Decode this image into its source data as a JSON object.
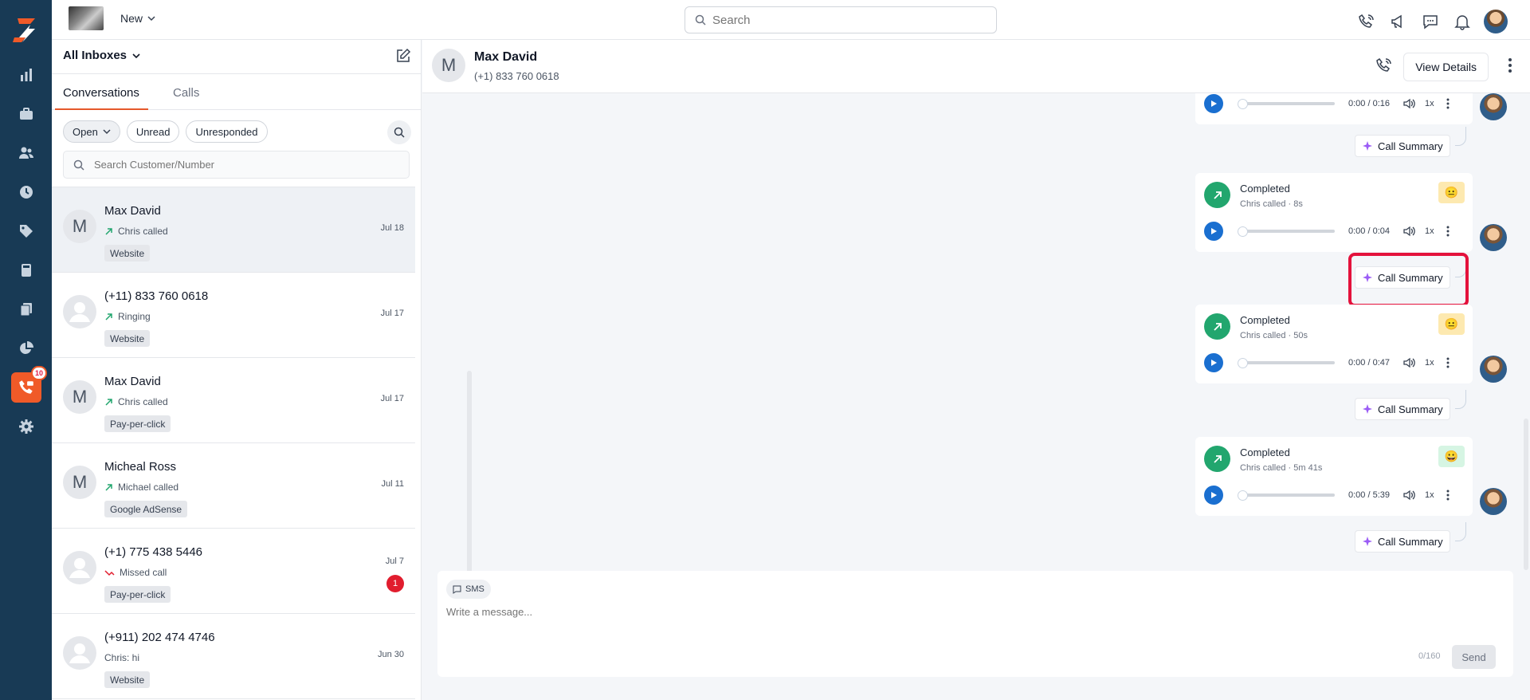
{
  "topbar": {
    "new_label": "New",
    "search_placeholder": "Search"
  },
  "rail": {
    "active_badge": "10"
  },
  "list": {
    "inbox_label": "All Inboxes",
    "tabs": [
      "Conversations",
      "Calls"
    ],
    "filters": {
      "open": "Open",
      "unread": "Unread",
      "unresponded": "Unresponded"
    },
    "search_placeholder": "Search Customer/Number",
    "rows": [
      {
        "initial": "M",
        "name": "Max David",
        "sub": "Chris called",
        "tag": "Website",
        "date": "Jul 18"
      },
      {
        "initial": "",
        "name": "(+11) 833 760 0618",
        "sub": "Ringing",
        "tag": "Website",
        "date": "Jul 17"
      },
      {
        "initial": "M",
        "name": "Max David",
        "sub": "Chris called",
        "tag": "Pay-per-click",
        "date": "Jul 17"
      },
      {
        "initial": "M",
        "name": "Micheal Ross",
        "sub": "Michael called",
        "tag": "Google AdSense",
        "date": "Jul 11"
      },
      {
        "initial": "",
        "name": "(+1) 775 438 5446",
        "sub": "Missed call",
        "tag": "Pay-per-click",
        "date": "Jul 7",
        "unread": "1"
      },
      {
        "initial": "",
        "name": "(+911) 202 474 4746",
        "sub": "Chris: hi",
        "tag": "Website",
        "date": "Jun 30"
      }
    ]
  },
  "chat": {
    "contact_initial": "M",
    "contact_name": "Max David",
    "contact_phone": "(+1) 833 760 0618",
    "view_details": "View Details",
    "first_player_time": "0:00 / 0:16",
    "speed": "1x",
    "summary_label": "Call Summary",
    "calls": [
      {
        "status": "Completed",
        "sub": "Chris called · 8s",
        "time": "0:00 / 0:04",
        "emoji": "😐",
        "emoji_bg": "#fde9b0"
      },
      {
        "status": "Completed",
        "sub": "Chris called · 50s",
        "time": "0:00 / 0:47",
        "emoji": "😐",
        "emoji_bg": "#fde9b0"
      },
      {
        "status": "Completed",
        "sub": "Chris called · 5m 41s",
        "time": "0:00 / 5:39",
        "emoji": "😀",
        "emoji_bg": "#d6f5e3"
      }
    ]
  },
  "composer": {
    "channel": "SMS",
    "placeholder": "Write a message...",
    "count": "0/160",
    "send": "Send"
  },
  "colors": {
    "rail": "#183a55",
    "accent": "#f05a28",
    "completed": "#22a66e",
    "play": "#1a6fd0",
    "highlight": "#e4123c"
  }
}
